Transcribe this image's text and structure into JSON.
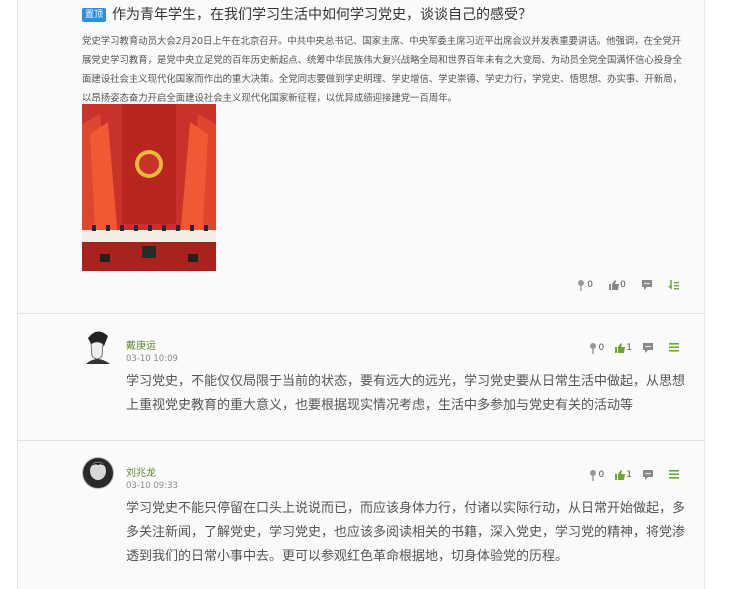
{
  "post": {
    "pin_label": "置顶",
    "title": "作为青年学生，在我们学习生活中如何学习党史，谈谈自己的感受？",
    "body": "党史学习教育动员大会2月20日上午在北京召开。中共中央总书记、国家主席、中央军委主席习近平出席会议并发表重要讲话。他强调，在全党开展党史学习教育，是党中央立足党的百年历史新起点、统筹中华民族伟大复兴战略全局和世界百年未有之大变局、为动员全党全国满怀信心投身全面建设社会主义现代化国家而作出的重大决策。全党同志要做到学史明理、学史增信、学史崇德、学史力行，学党史、悟思想、办实事、开新局，以昂扬姿态奋力开启全面建设社会主义现代化国家新征程，以优异成绩迎接建党一百周年。",
    "image_icon": "party-emblem-meeting-photo",
    "flower_count": "0",
    "like_count": "0"
  },
  "comments": [
    {
      "name": "戴庚运",
      "time": "03-10 10:09",
      "text": "学习党史，不能仅仅局限于当前的状态，要有远大的远光，学习党史要从日常生活中做起，从思想上重视党史教育的重大意义，也要根据现实情况考虑，生活中多参加与党史有关的活动等",
      "flower_count": "0",
      "like_count": "1"
    },
    {
      "name": "刘兆龙",
      "time": "03-10 09:33",
      "text": "学习党史不能只停留在口头上说说而已，而应该身体力行，付诸以实际行动，从日常开始做起，多多关注新闻，了解党史，学习党史，也应该多阅读相关的书籍，深入党史，学习党的精神，将党渗透到我们的日常小事中去。更可以参观红色革命根据地，切身体验党的历程。",
      "flower_count": "0",
      "like_count": "1"
    }
  ],
  "colors": {
    "accent_green": "#6aa82e",
    "pin_blue": "#2f8ee0",
    "name_green": "#5a8a2e"
  }
}
